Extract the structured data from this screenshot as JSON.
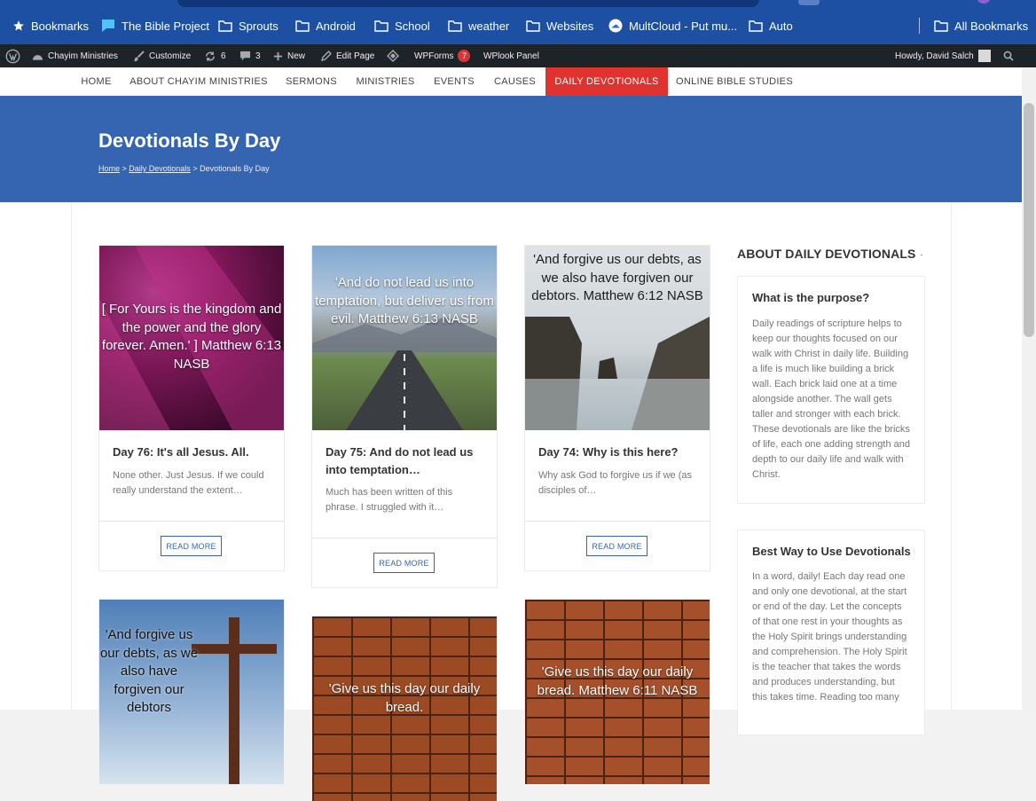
{
  "bookmarks": {
    "items": [
      {
        "label": "Bookmarks",
        "icon": "star-icon"
      },
      {
        "label": "The Bible Project",
        "icon": "flag-icon"
      },
      {
        "label": "Sprouts",
        "icon": "folder-icon"
      },
      {
        "label": "Android",
        "icon": "folder-icon"
      },
      {
        "label": "School",
        "icon": "folder-icon"
      },
      {
        "label": "weather",
        "icon": "folder-icon"
      },
      {
        "label": "Websites",
        "icon": "folder-icon"
      },
      {
        "label": "MultCloud - Put mu...",
        "icon": "cloud-icon"
      },
      {
        "label": "Auto",
        "icon": "folder-icon"
      }
    ],
    "all_label": "All Bookmarks"
  },
  "admin_bar": {
    "site_name": "Chayim Ministries",
    "customize": "Customize",
    "updates_count": "6",
    "comments_count": "3",
    "new_label": "New",
    "edit_page": "Edit Page",
    "wpforms": "WPForms",
    "wpforms_count": "7",
    "wplook": "WPlook Panel",
    "howdy": "Howdy, David Salch"
  },
  "nav": {
    "items": [
      {
        "label": "HOME"
      },
      {
        "label": "ABOUT CHAYIM MINISTRIES"
      },
      {
        "label": "SERMONS"
      },
      {
        "label": "MINISTRIES"
      },
      {
        "label": "EVENTS"
      },
      {
        "label": "CAUSES"
      },
      {
        "label": "DAILY DEVOTIONALS"
      },
      {
        "label": "ONLINE BIBLE STUDIES"
      }
    ],
    "active_index": 6
  },
  "hero": {
    "title": "Devotionals By Day",
    "crumb_home": "Home",
    "crumb_sep1": " > ",
    "crumb_section": "Daily Devotionals",
    "crumb_sep2": " > ",
    "crumb_current": "Devotionals By Day"
  },
  "posts": [
    {
      "image_text": "[ For Yours is the kingdom and the power and the glory forever. Amen.' ] Matthew 6:13 NASB",
      "title": "Day 76: It's all Jesus. All.",
      "excerpt": "None other. Just Jesus. If we could really understand the extent…",
      "read_more": "READ MORE"
    },
    {
      "image_text": "'And do not lead us into temptation, but deliver us from evil. Matthew 6:13 NASB",
      "title": "Day 75: And do not lead us into temptation…",
      "excerpt": "Much has been written of this phrase. I struggled with it…",
      "read_more": "READ MORE"
    },
    {
      "image_text": "'And forgive us our debts, as we also have forgiven our debtors. Matthew 6:12 NASB",
      "title": "Day 74: Why is this here?",
      "excerpt": "Why ask God to forgive us if we (as disciples of…",
      "read_more": "READ MORE"
    },
    {
      "image_text": "'And forgive us our debts, as we also have forgiven our debtors"
    },
    {
      "image_text": "'Give us this day our daily bread."
    },
    {
      "image_text": "'Give us this day our daily bread. Matthew 6:11 NASB"
    }
  ],
  "sidebar": {
    "heading": "ABOUT DAILY DEVOTIONALS",
    "widgets": [
      {
        "title": "What is the purpose?",
        "text": "Daily readings of scripture helps to keep our thoughts focused on our walk with Christ in daily life. Building a life is much like building a brick wall. Each brick laid one at a time alongside another. The wall gets taller and stronger with each brick. These devotionals are like the bricks of life, each one adding strength and depth to our daily life and walk with Christ."
      },
      {
        "title": "Best Way to Use Devotionals",
        "text": "In a word, daily! Each day read one and only one devotional, at the start or end of the day. Let the concepts of that one rest in your thoughts as the Holy Spirit brings understanding and comprehension. The Holy Spirit is the teacher that takes the words and produces understanding, but this takes time. Reading too many"
      }
    ]
  },
  "colors": {
    "bookmarks_bar": "#1d4fa3",
    "admin_bar": "#1d2327",
    "hero": "#3565b0",
    "nav_active": "#e0332f",
    "read_more": "#3565b0"
  }
}
